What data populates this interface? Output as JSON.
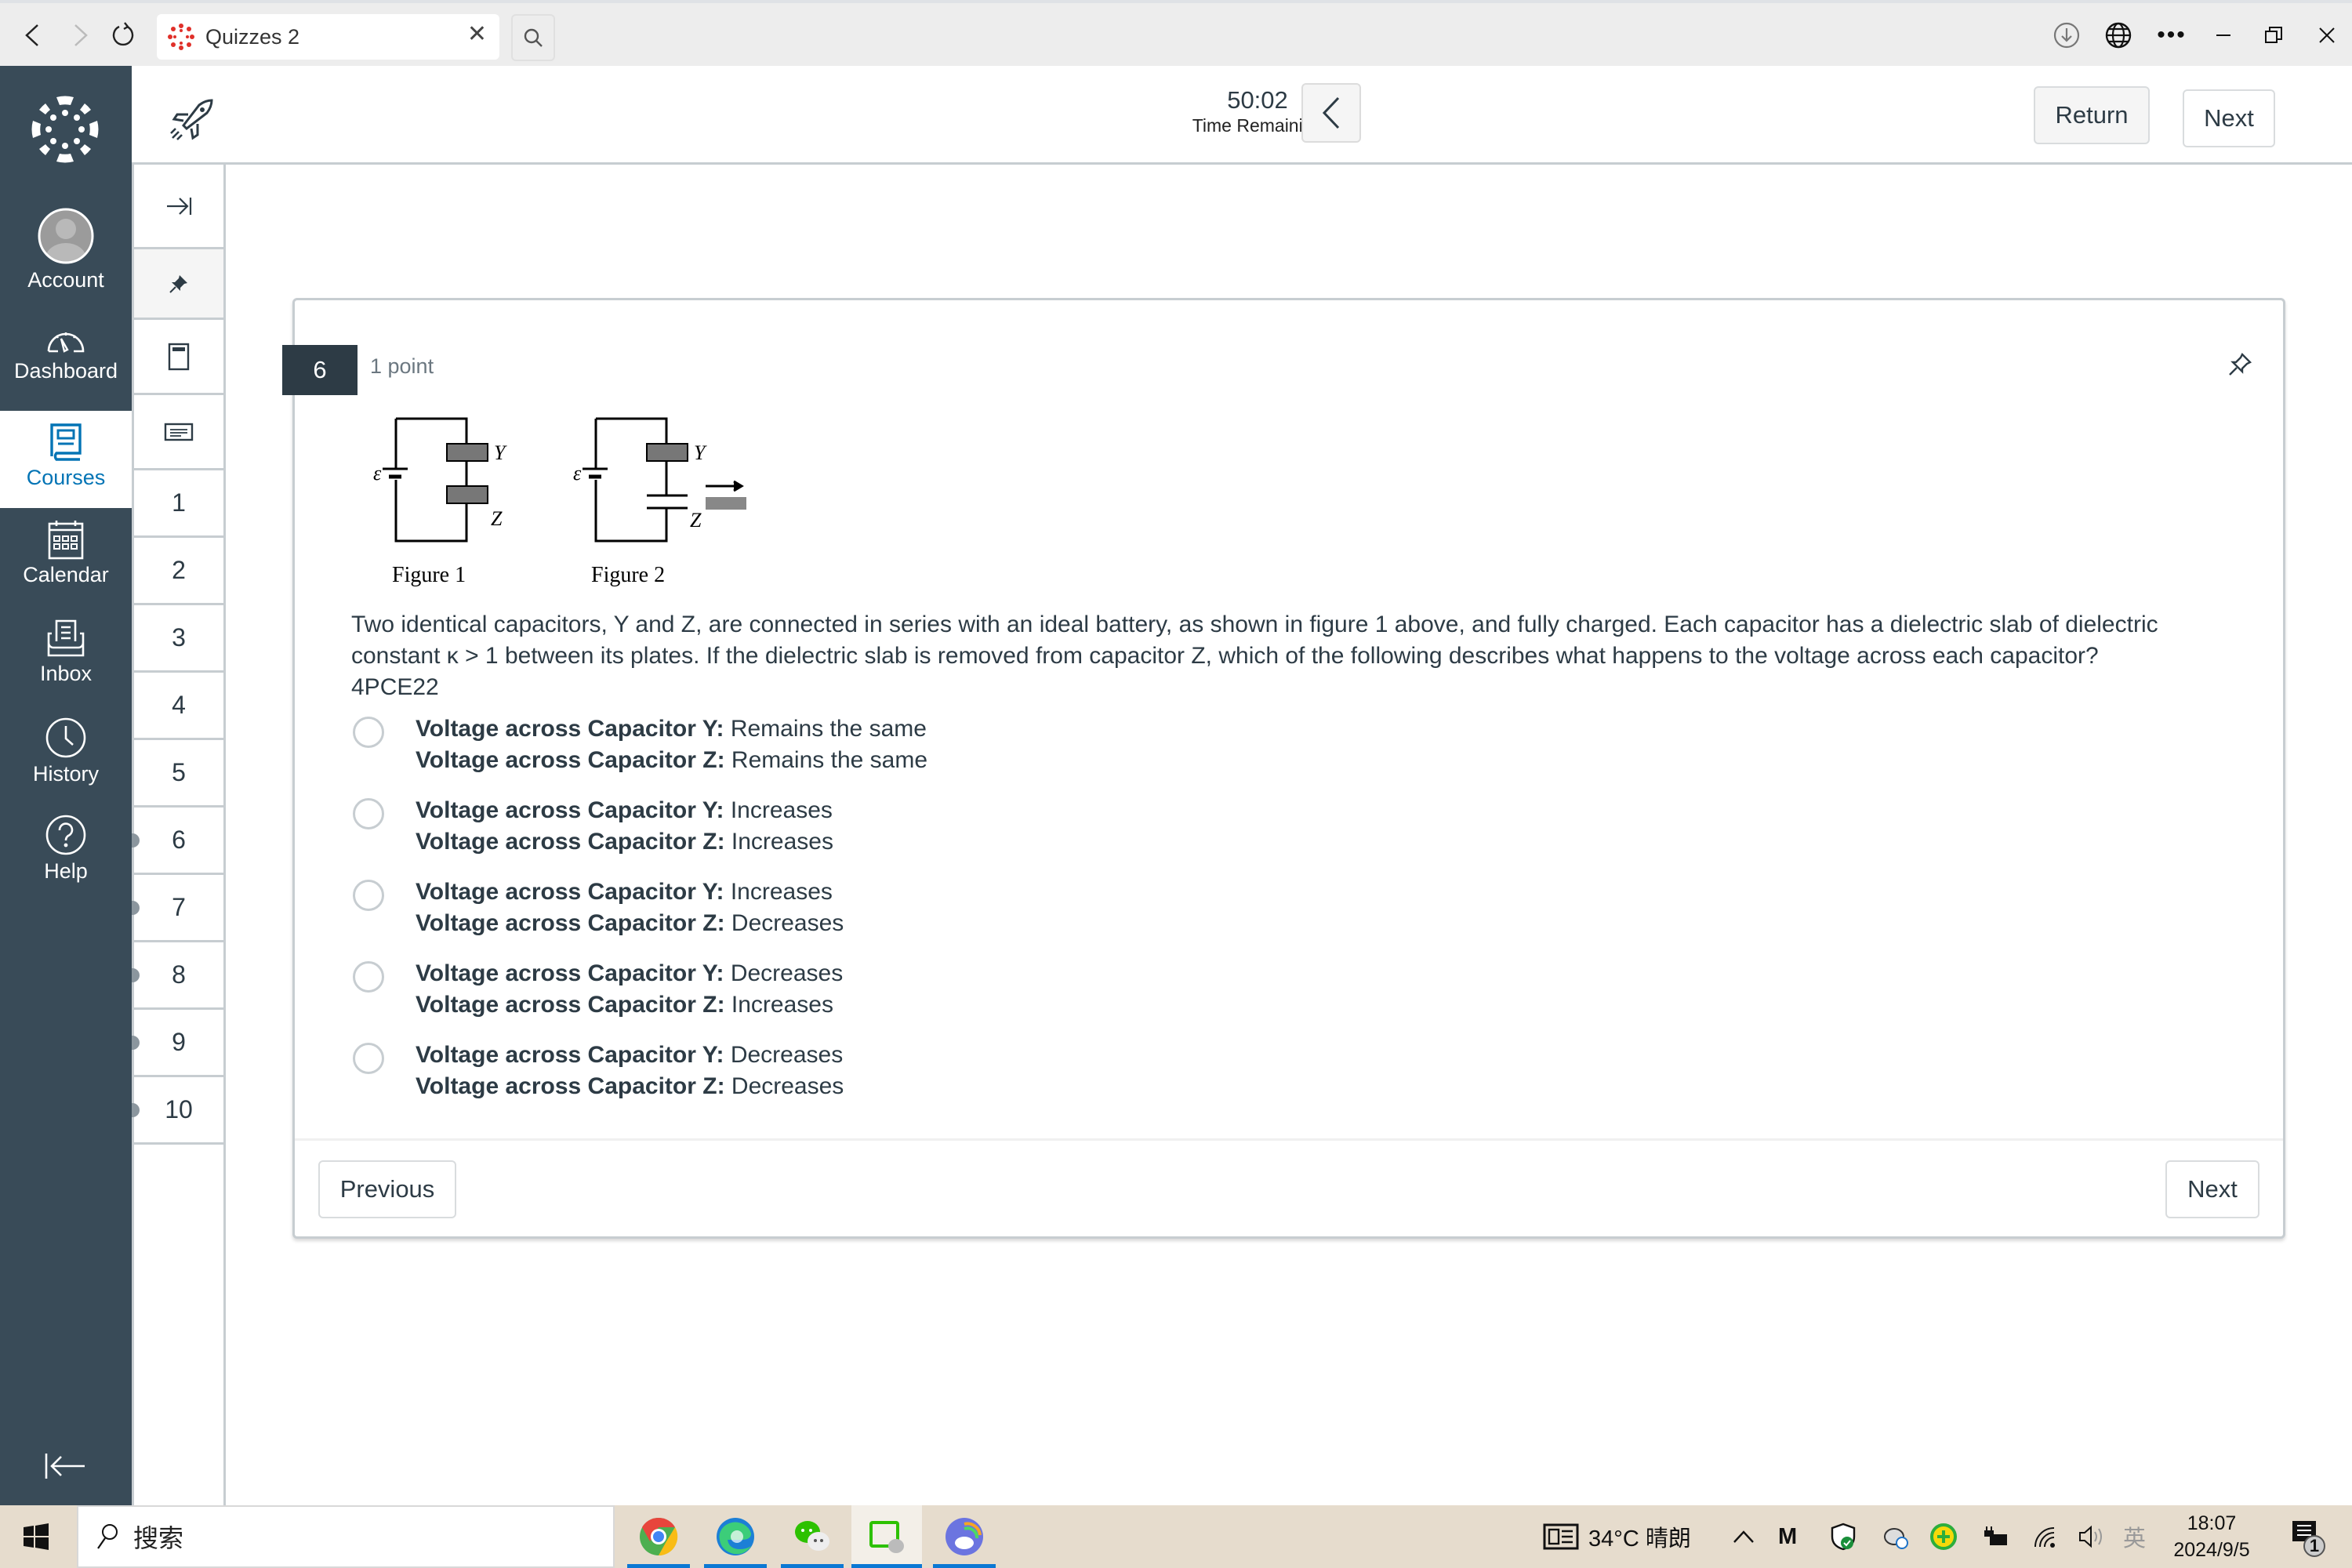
{
  "browser": {
    "tab_title": "Quizzes 2",
    "icons": [
      "back-icon",
      "forward-icon",
      "reload-icon",
      "canvas-favicon",
      "close-tab-icon",
      "search-icon",
      "download-icon",
      "globe-icon",
      "more-icon",
      "minimize-icon",
      "restore-icon",
      "close-window-icon"
    ]
  },
  "global_nav": {
    "items": [
      {
        "label": "Account",
        "icon": "avatar-icon"
      },
      {
        "label": "Dashboard",
        "icon": "dashboard-icon"
      },
      {
        "label": "Courses",
        "icon": "courses-icon",
        "active": true
      },
      {
        "label": "Calendar",
        "icon": "calendar-icon"
      },
      {
        "label": "Inbox",
        "icon": "inbox-icon"
      },
      {
        "label": "History",
        "icon": "history-icon"
      },
      {
        "label": "Help",
        "icon": "help-icon"
      }
    ],
    "collapse_icon": "collapse-nav-icon"
  },
  "quiz_nav": {
    "tools": [
      "expand-icon",
      "pin-icon",
      "calculator-icon",
      "notes-icon"
    ],
    "questions": [
      {
        "label": "1",
        "answered": false
      },
      {
        "label": "2",
        "answered": false
      },
      {
        "label": "3",
        "answered": false
      },
      {
        "label": "4",
        "answered": false
      },
      {
        "label": "5",
        "answered": false
      },
      {
        "label": "6",
        "answered": true
      },
      {
        "label": "7",
        "answered": true
      },
      {
        "label": "8",
        "answered": true
      },
      {
        "label": "9",
        "answered": true
      },
      {
        "label": "10",
        "answered": true
      }
    ]
  },
  "header": {
    "timer_value": "50:02",
    "timer_label": "Time Remaining",
    "return_label": "Return",
    "next_label": "Next"
  },
  "question": {
    "number": "6",
    "points": "1 point",
    "figure_labels": {
      "fig1": "Figure 1",
      "fig2": "Figure 2",
      "emf": "ε",
      "cap_y": "Y",
      "cap_z": "Z"
    },
    "text_line1": "Two identical capacitors, Y and Z, are connected in series with an ideal battery, as shown in figure 1 above, and fully charged. Each capacitor has a dielectric slab of dielectric",
    "text_line2": "constant κ > 1 between its plates. If the dielectric slab is removed from capacitor Z, which of the following describes what happens to the voltage across each capacitor?",
    "text_line3": "4PCE22",
    "answers": [
      {
        "y_label": "Voltage across Capacitor Y:",
        "y_value": "Remains the same",
        "z_label": "Voltage across Capacitor Z:",
        "z_value": "Remains the same",
        "selected": false
      },
      {
        "y_label": "Voltage across Capacitor Y:",
        "y_value": "Increases",
        "z_label": "Voltage across Capacitor Z:",
        "z_value": "Increases",
        "selected": false
      },
      {
        "y_label": "Voltage across Capacitor Y:",
        "y_value": "Increases",
        "z_label": "Voltage across Capacitor Z:",
        "z_value": "Decreases",
        "selected": false
      },
      {
        "y_label": "Voltage across Capacitor Y:",
        "y_value": "Decreases",
        "z_label": "Voltage across Capacitor Z:",
        "z_value": "Increases",
        "selected": false
      },
      {
        "y_label": "Voltage across Capacitor Y:",
        "y_value": "Decreases",
        "z_label": "Voltage across Capacitor Z:",
        "z_value": "Decreases",
        "selected": false
      }
    ],
    "previous_label": "Previous",
    "next_label": "Next"
  },
  "taskbar": {
    "search_placeholder": "搜索",
    "apps": [
      "chrome-icon",
      "edge-icon",
      "wechat-icon",
      "wechat-devtools-icon",
      "cloud-app-icon"
    ],
    "weather": "34°C 晴朗",
    "ime": "英",
    "time": "18:07",
    "date": "2024/9/5",
    "notification_count": "1"
  },
  "colors": {
    "nav_bg": "#394b58",
    "accent": "#0374b5",
    "text": "#2d3b45",
    "qnum_bg": "#2d3b45"
  }
}
